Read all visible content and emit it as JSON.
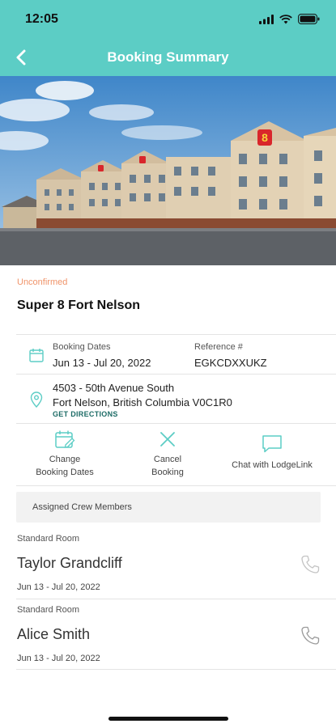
{
  "status_bar": {
    "time": "12:05"
  },
  "header": {
    "title": "Booking Summary"
  },
  "booking": {
    "status": "Unconfirmed",
    "hotel_name": "Super 8 Fort Nelson",
    "dates_label": "Booking Dates",
    "dates_value": "Jun 13 - Jul 20, 2022",
    "reference_label": "Reference #",
    "reference_value": "EGKCDXXUKZ",
    "address_line1": "4503 - 50th Avenue South",
    "address_line2": "Fort Nelson, British Columbia V0C1R0",
    "directions_label": "GET DIRECTIONS"
  },
  "actions": {
    "change_line1": "Change",
    "change_line2": "Booking Dates",
    "cancel_line1": "Cancel",
    "cancel_line2": "Booking",
    "chat": "Chat with LodgeLink"
  },
  "crew": {
    "section_label": "Assigned Crew Members",
    "members": [
      {
        "room_type": "Standard Room",
        "name": "Taylor Grandcliff",
        "dates": "Jun 13 - Jul 20, 2022"
      },
      {
        "room_type": "Standard Room",
        "name": "Alice Smith",
        "dates": "Jun 13 - Jul 20, 2022"
      }
    ]
  },
  "hotel_sign": "8",
  "colors": {
    "accent": "#5ccdc5",
    "status_unconfirmed": "#f0946a",
    "link": "#1c6b66"
  },
  "icons": [
    "back-chevron-icon",
    "calendar-icon",
    "location-pin-icon",
    "calendar-edit-icon",
    "close-icon",
    "chat-bubble-icon",
    "phone-icon"
  ]
}
